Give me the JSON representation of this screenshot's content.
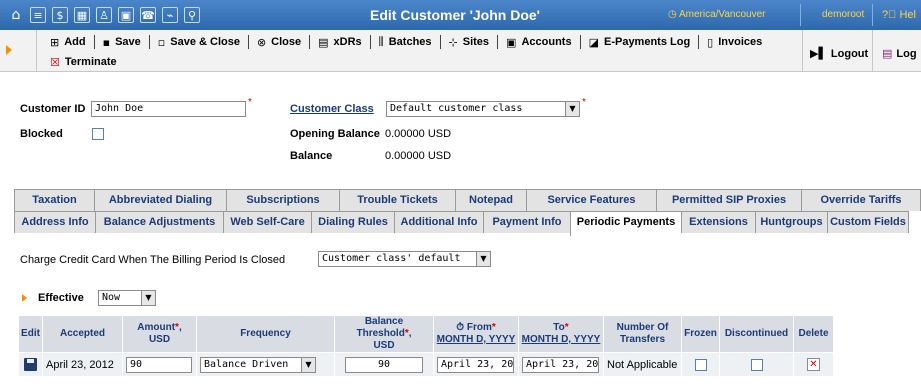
{
  "topbar": {
    "title": "Edit Customer 'John Doe'",
    "timezone": "America/Vancouver",
    "timezone_icon": "clock-icon",
    "user": "demoroot",
    "help": "Hel",
    "icons": [
      "home-icon",
      "list-icon",
      "dollar-icon",
      "grid-icon",
      "person-icon",
      "phone-book-icon",
      "phone-icon",
      "chart-icon",
      "search-icon"
    ]
  },
  "toolbar": {
    "row1": [
      {
        "icon": "add-icon",
        "label": "Add"
      },
      {
        "icon": "save-icon",
        "label": "Save"
      },
      {
        "icon": "save-close-icon",
        "label": "Save & Close"
      },
      {
        "icon": "close-icon",
        "label": "Close"
      },
      {
        "icon": "xdrs-icon",
        "label": "xDRs"
      },
      {
        "icon": "batches-icon",
        "label": "Batches"
      },
      {
        "icon": "sites-icon",
        "label": "Sites"
      },
      {
        "icon": "accounts-icon",
        "label": "Accounts"
      },
      {
        "icon": "e-payments-icon",
        "label": "E-Payments Log"
      },
      {
        "icon": "invoices-icon",
        "label": "Invoices"
      }
    ],
    "row2": [
      {
        "icon": "terminate-icon",
        "label": "Terminate"
      }
    ],
    "logout": "Logout",
    "log": "Log"
  },
  "customer": {
    "id_label": "Customer ID",
    "id_value": "John Doe",
    "blocked_label": "Blocked",
    "class_label": "Customer Class",
    "class_value": "Default customer class",
    "opening_balance_label": "Opening Balance",
    "opening_balance_value": "0.00000 USD",
    "balance_label": "Balance",
    "balance_value": "0.00000 USD"
  },
  "tabs": {
    "row1": [
      "Taxation",
      "Abbreviated Dialing",
      "Subscriptions",
      "Trouble Tickets",
      "Notepad",
      "Service Features",
      "Permitted SIP Proxies",
      "Override Tariffs"
    ],
    "row2": [
      "Address Info",
      "Balance Adjustments",
      "Web Self-Care",
      "Dialing Rules",
      "Additional Info",
      "Payment Info",
      "Periodic Payments",
      "Extensions",
      "Huntgroups",
      "Custom Fields"
    ],
    "active": "Periodic Payments"
  },
  "periodic": {
    "charge_label": "Charge Credit Card When The Billing Period Is Closed",
    "charge_value": "Customer class' default",
    "effective_label": "Effective",
    "effective_value": "Now",
    "columns": {
      "edit": "Edit",
      "accepted": "Accepted",
      "amount": "Amount",
      "amount_unit": "USD",
      "frequency": "Frequency",
      "threshold": "Balance Threshold",
      "threshold_unit": "USD",
      "from": "From",
      "from_format": "MONTH D, YYYY",
      "to": "To",
      "to_format": "MONTH D, YYYY",
      "transfers": "Number Of Transfers",
      "frozen": "Frozen",
      "discontinued": "Discontinued",
      "delete": "Delete"
    },
    "row": {
      "accepted": "April 23, 2012",
      "amount": "90",
      "frequency": "Balance Driven",
      "threshold": "90",
      "from": "April 23, 20",
      "to": "April 23, 20",
      "transfers": "Not Applicable"
    }
  }
}
